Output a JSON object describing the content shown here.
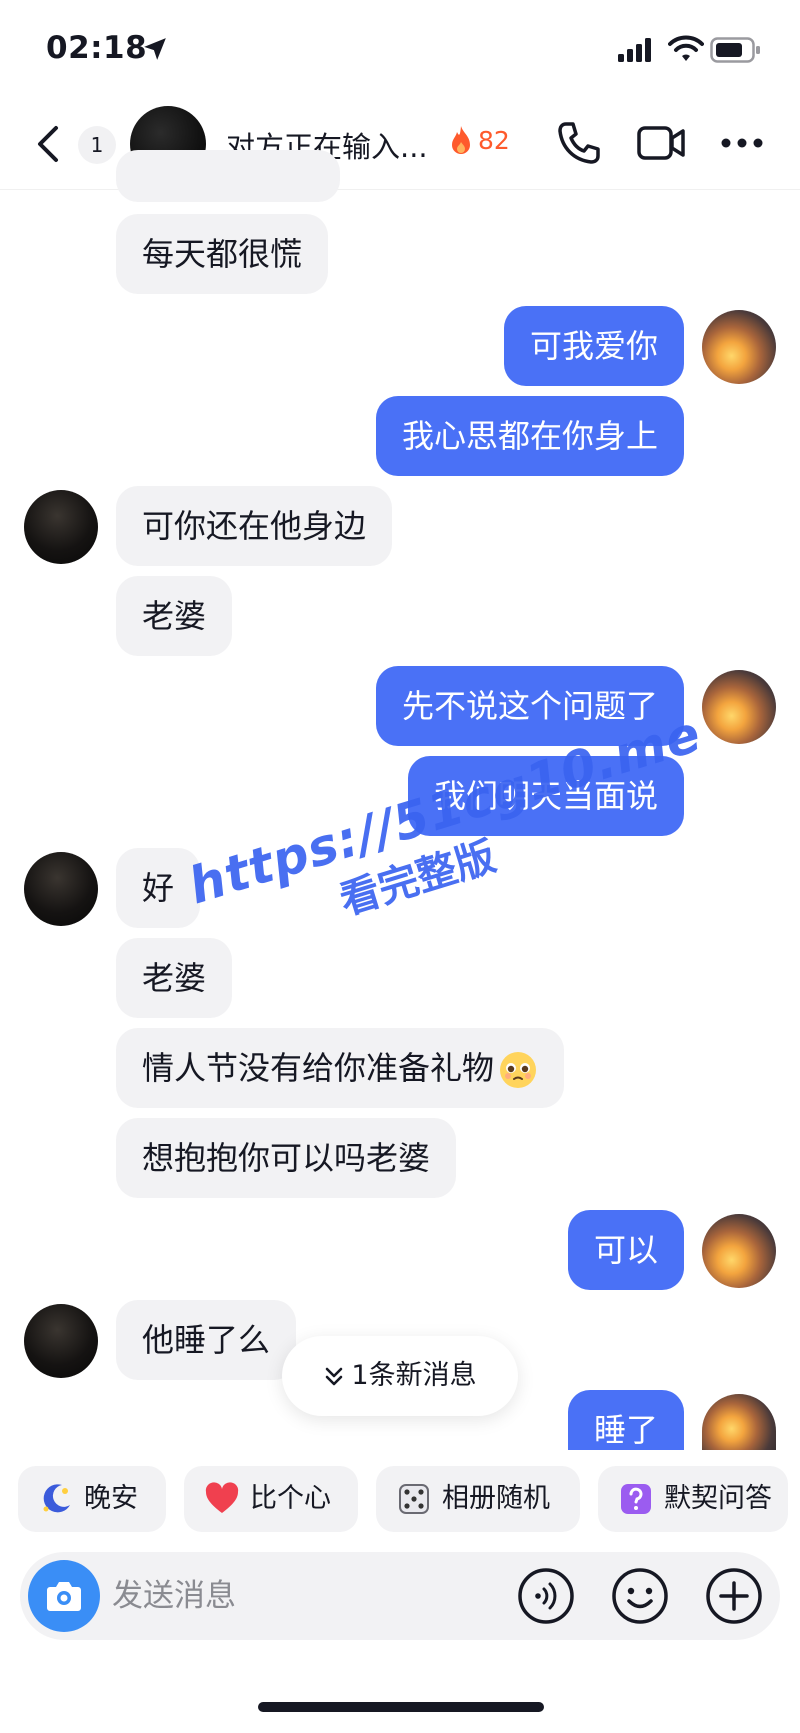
{
  "status_bar": {
    "time": "02:18"
  },
  "header": {
    "unread_count": "1",
    "title": "对方正在输入...",
    "streak": "82"
  },
  "messages": [
    {
      "side": "in",
      "text": "每天都很慌"
    },
    {
      "side": "out",
      "text": "可我爱你"
    },
    {
      "side": "out",
      "text": "我心思都在你身上"
    },
    {
      "side": "in",
      "text": "可你还在他身边"
    },
    {
      "side": "in",
      "text": "老婆"
    },
    {
      "side": "out",
      "text": "先不说这个问题了"
    },
    {
      "side": "out",
      "text": "我们明天当面说"
    },
    {
      "side": "in",
      "text": "好"
    },
    {
      "side": "in",
      "text": "老婆"
    },
    {
      "side": "in",
      "text": "情人节没有给你准备礼物",
      "emoji": "pleading-face-icon"
    },
    {
      "side": "in",
      "text": "想抱抱你可以吗老婆"
    },
    {
      "side": "out",
      "text": "可以"
    },
    {
      "side": "in",
      "text": "他睡了么"
    },
    {
      "side": "out",
      "text": "睡了"
    }
  ],
  "new_messages_pill": "1条新消息",
  "watermark": {
    "url": "https://51cg10.me",
    "text": "看完整版"
  },
  "quick_replies": [
    {
      "label": "晚安",
      "icon": "moon-icon"
    },
    {
      "label": "比个心",
      "icon": "heart-icon"
    },
    {
      "label": "相册随机",
      "icon": "dice-icon"
    },
    {
      "label": "默契问答",
      "icon": "question-icon"
    }
  ],
  "input": {
    "placeholder": "发送消息"
  },
  "colors": {
    "outgoing_bubble": "#4a71f6",
    "incoming_bubble": "#f2f2f4",
    "streak": "#fe5a2c",
    "camera_button": "#3a8ef6",
    "watermark": "#3a63f0"
  }
}
